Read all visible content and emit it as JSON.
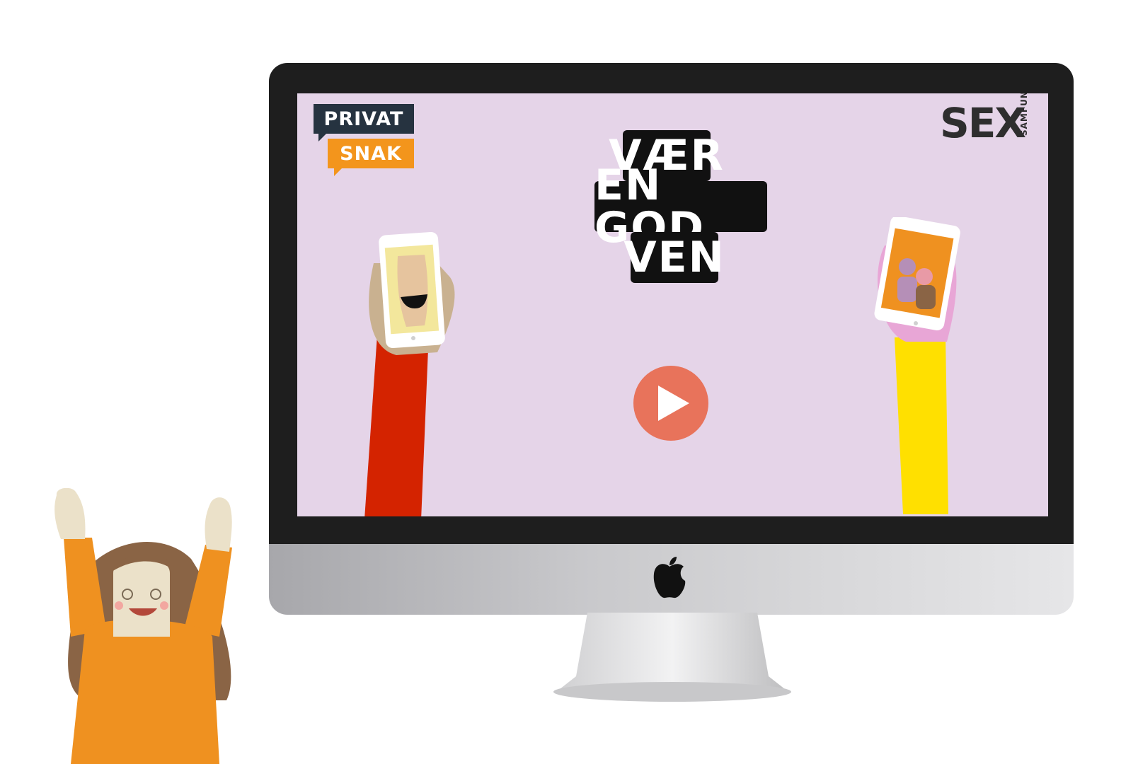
{
  "logo_privat_snak": {
    "line1": "PRIVAT",
    "line2": "SNAK"
  },
  "logo_sex_samfund": {
    "word": "SEX",
    "sub": "SAMFUND"
  },
  "title": {
    "line1": "VÆR",
    "line2": "EN GOD",
    "line3": "VEN"
  },
  "colors": {
    "screen_background": "#e5d4e8",
    "play_button": "#e8735b",
    "left_sleeve": "#d42300",
    "right_sleeve": "#ffe000",
    "privat_box": "#263340",
    "snak_box": "#f3951c",
    "character_shirt": "#ef9120",
    "character_hair": "#8a6445"
  },
  "icons": {
    "play": "play-icon",
    "apple": "apple-logo-icon"
  }
}
